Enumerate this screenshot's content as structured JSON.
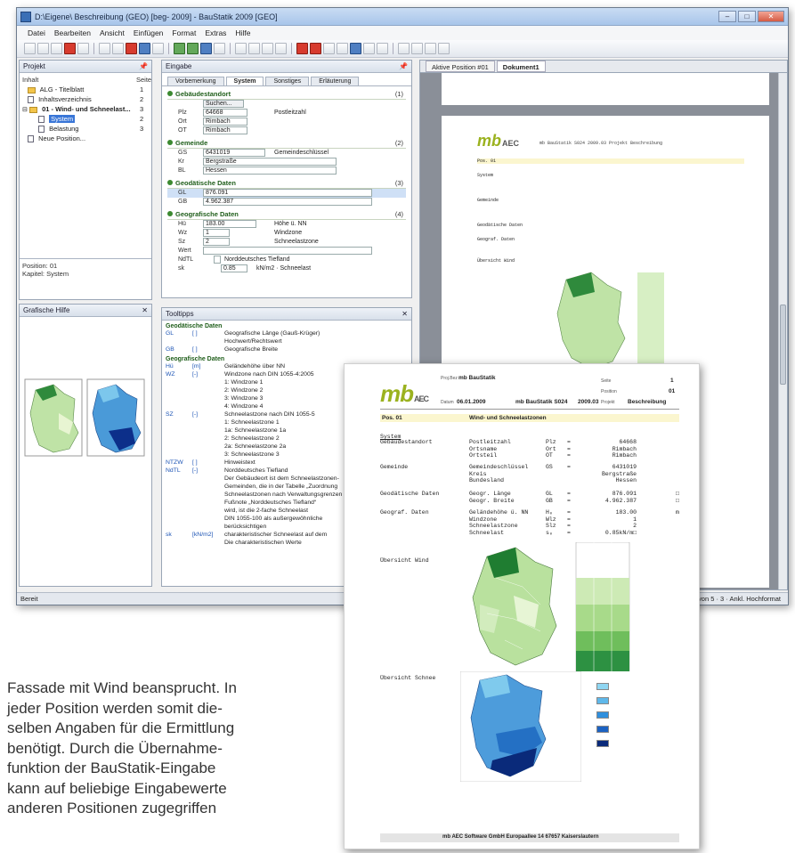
{
  "window": {
    "title": "D:\\Eigene\\ Beschreibung (GEO) [beg- 2009] - BauStatik 2009 [GEO]",
    "menu": [
      "Datei",
      "Bearbeiten",
      "Ansicht",
      "Einfügen",
      "Format",
      "Extras",
      "Hilfe"
    ]
  },
  "projekt_panel": {
    "title": "Projekt",
    "col_label": "Inhalt",
    "col_page": "Seite",
    "items": [
      {
        "label": "ALG - Titelblatt",
        "page": "1"
      },
      {
        "label": "Inhaltsverzeichnis",
        "page": "2"
      },
      {
        "label": "01 - Wind- und Schneelast...",
        "page": "3"
      },
      {
        "label": "System",
        "page": "2"
      },
      {
        "label": "Belastung",
        "page": "3"
      },
      {
        "label": "Neue Position...",
        "page": ""
      }
    ],
    "info_line1": "Position: 01",
    "info_line2": "Kapitel: System"
  },
  "grafik_panel": {
    "title": "Grafische Hilfe"
  },
  "eingabe_panel": {
    "title": "Eingabe",
    "tabs": [
      "Vorbemerkung",
      "System",
      "Sonstiges",
      "Erläuterung"
    ],
    "groups": [
      {
        "title": "Gebäudestandort",
        "count": "(1)",
        "rows": [
          {
            "k": "",
            "v": "Suchen...",
            "d": ""
          },
          {
            "k": "Plz",
            "v": "64668",
            "d": "Postleitzahl"
          },
          {
            "k": "Ort",
            "v": "Rimbach",
            "d": ""
          },
          {
            "k": "OT",
            "v": "Rimbach",
            "d": ""
          }
        ]
      },
      {
        "title": "Gemeinde",
        "count": "(2)",
        "rows": [
          {
            "k": "GS",
            "v": "6431019",
            "d": "Gemeindeschlüssel"
          },
          {
            "k": "Kr",
            "v": "Bergstraße",
            "d": ""
          },
          {
            "k": "BL",
            "v": "Hessen",
            "d": ""
          }
        ]
      },
      {
        "title": "Geodätische Daten",
        "count": "(3)",
        "rows": [
          {
            "k": "GL",
            "v": "876.091",
            "d": ""
          },
          {
            "k": "GB",
            "v": "4.962.387",
            "d": ""
          }
        ]
      },
      {
        "title": "Geografische Daten",
        "count": "(4)",
        "rows": [
          {
            "k": "Hü",
            "v": "183.00",
            "d": "Höhe ü. NN"
          },
          {
            "k": "Wz",
            "v": "1",
            "d": "Windzone"
          },
          {
            "k": "Sz",
            "v": "2",
            "d": "Schneelastzone"
          },
          {
            "k": "Wert",
            "v": "",
            "d": ""
          },
          {
            "k": "NdTL",
            "v": "",
            "d": "Norddeutsches Tiefland"
          },
          {
            "k": "sk",
            "v": "0.85",
            "d": "kN/m2 · Schneelast"
          }
        ]
      }
    ]
  },
  "tooltip_panel": {
    "title": "Tooltipps",
    "sections": [
      {
        "title": "Geodätische Daten",
        "lines": [
          {
            "k": "GL",
            "u": "[ ]",
            "t": "Geografische Länge (Gauß-Krüger)"
          },
          {
            "k": "",
            "u": "",
            "t": "Hochwert/Rechtswert"
          },
          {
            "k": "GB",
            "u": "[ ]",
            "t": "Geografische Breite"
          }
        ]
      },
      {
        "title": "Geografische Daten",
        "lines": [
          {
            "k": "Hü",
            "u": "[m]",
            "t": "Geländehöhe über NN"
          },
          {
            "k": "WZ",
            "u": "[-]",
            "t": "Windzone nach DIN 1055-4:2005"
          },
          {
            "k": "",
            "u": "",
            "t": "1: Windzone 1"
          },
          {
            "k": "",
            "u": "",
            "t": "2: Windzone 2"
          },
          {
            "k": "",
            "u": "",
            "t": "3: Windzone 3"
          },
          {
            "k": "",
            "u": "",
            "t": "4: Windzone 4"
          },
          {
            "k": "SZ",
            "u": "[-]",
            "t": "Schneelastzone nach DIN 1055-5"
          },
          {
            "k": "",
            "u": "",
            "t": "1: Schneelastzone 1"
          },
          {
            "k": "",
            "u": "",
            "t": "1a: Schneelastzone 1a"
          },
          {
            "k": "",
            "u": "",
            "t": "2: Schneelastzone 2"
          },
          {
            "k": "",
            "u": "",
            "t": "2a: Schneelastzone 2a"
          },
          {
            "k": "",
            "u": "",
            "t": "3: Schneelastzone 3"
          },
          {
            "k": "NTZW",
            "u": "[ ]",
            "t": "Hinweistext"
          },
          {
            "k": "NdTL",
            "u": "[-]",
            "t": "Norddeutsches Tiefland"
          },
          {
            "k": "",
            "u": "",
            "t": "Der Gebäudeort ist dem Schneelastzonen-"
          },
          {
            "k": "",
            "u": "",
            "t": "Gemeinden, die in der Tabelle „Zuordnung"
          },
          {
            "k": "",
            "u": "",
            "t": "Schneelastzonen nach Verwaltungsgrenzen"
          },
          {
            "k": "",
            "u": "",
            "t": "Fußnote „Norddeutsches Tiefland“"
          },
          {
            "k": "",
            "u": "",
            "t": "wird, ist die 2-fache Schneelast"
          },
          {
            "k": "",
            "u": "",
            "t": "DIN 1055-100 als außergewöhnliche"
          },
          {
            "k": "",
            "u": "",
            "t": "berücksichtigen"
          },
          {
            "k": "sk",
            "u": "[kN/m2]",
            "t": "charakteristischer Schneelast auf dem"
          },
          {
            "k": "",
            "u": "",
            "t": "Die charakteristischen Werte"
          }
        ]
      }
    ]
  },
  "doc_tabs": [
    "Aktive Position #01",
    "Dokument1"
  ],
  "statusbar": {
    "left": "Bereit",
    "right": "Seite 1 von 5 · 3 · Ankl. Hochformat"
  },
  "doc_back": {
    "top_line": "mb BauStatik S024 2009.03 Projekt Beschreibung",
    "rows": [
      "Pos. 01",
      "System",
      "Gemeinde",
      "Geodätische Daten",
      "Geograf. Daten",
      "Übersicht Wind"
    ]
  },
  "doc_front": {
    "header": {
      "proj_label": "Proj.Bez",
      "proj_value": "mb BauStatik",
      "datum_label": "Datum",
      "datum_value": "06.01.2009",
      "product": "mb BauStatik S024",
      "version": "2009.03",
      "seite_label": "Seite",
      "seite_value": "1",
      "position_label": "Position",
      "position_value": "01",
      "projekt_label": "Projekt",
      "projekt_value": "Beschreibung",
      "logo_mb": "mb",
      "logo_aec": "AEC"
    },
    "pos": "Pos. 01",
    "pos_title": "Wind- und Schneelastzonen",
    "section_system": "System",
    "rows": [
      {
        "label": "Gebäudestandort",
        "items": [
          [
            "Postleitzahl",
            "Plz",
            "=",
            "64668",
            ""
          ],
          [
            "Ortsname",
            "Ort",
            "=",
            "Rimbach",
            ""
          ],
          [
            "Ortsteil",
            "OT",
            "=",
            "Rimbach",
            ""
          ]
        ]
      },
      {
        "label": "Gemeinde",
        "items": [
          [
            "Gemeindeschlüssel",
            "GS",
            "=",
            "6431019",
            ""
          ],
          [
            "Kreis",
            "",
            "",
            "Bergstraße",
            ""
          ],
          [
            "Bundesland",
            "",
            "",
            "Hessen",
            ""
          ]
        ]
      },
      {
        "label": "Geodätische Daten",
        "items": [
          [
            "Geogr. Länge",
            "GL",
            "=",
            "876.091",
            "□"
          ],
          [
            "Geogr. Breite",
            "GB",
            "=",
            "4.962.387",
            "□"
          ]
        ]
      },
      {
        "label": "Geograf. Daten",
        "items": [
          [
            "Geländehöhe ü. NN",
            "H₀",
            "=",
            "183.00",
            "m"
          ],
          [
            "Windzone",
            "Wlz",
            "=",
            "1",
            ""
          ],
          [
            "Schneelastzone",
            "Slz",
            "=",
            "2",
            ""
          ],
          [
            "Schneelast",
            "s₀",
            "=",
            "0.85kN/m□",
            ""
          ]
        ]
      }
    ],
    "uebersicht_wind": "Übersicht Wind",
    "uebersicht_schnee": "Übersicht Schnee",
    "footer": "mb AEC Software GmbH   Europaallee 14   67657 Kaiserslautern"
  },
  "body_text": [
    "Fassade mit Wind beansprucht. In",
    "jeder Position werden somit die-",
    "selben Angaben für die Ermittlung",
    "benötigt. Durch die Übernahme-",
    "funktion der BauStatik-Eingabe",
    "kann auf beliebige Eingabewerte",
    "anderen Positionen zugegriffen"
  ],
  "colors": {
    "accent_green": "#9bb21f",
    "title_blue": "#a8c5ea",
    "selection": "#3875d7",
    "pos_bar": "#fbf6cf"
  }
}
